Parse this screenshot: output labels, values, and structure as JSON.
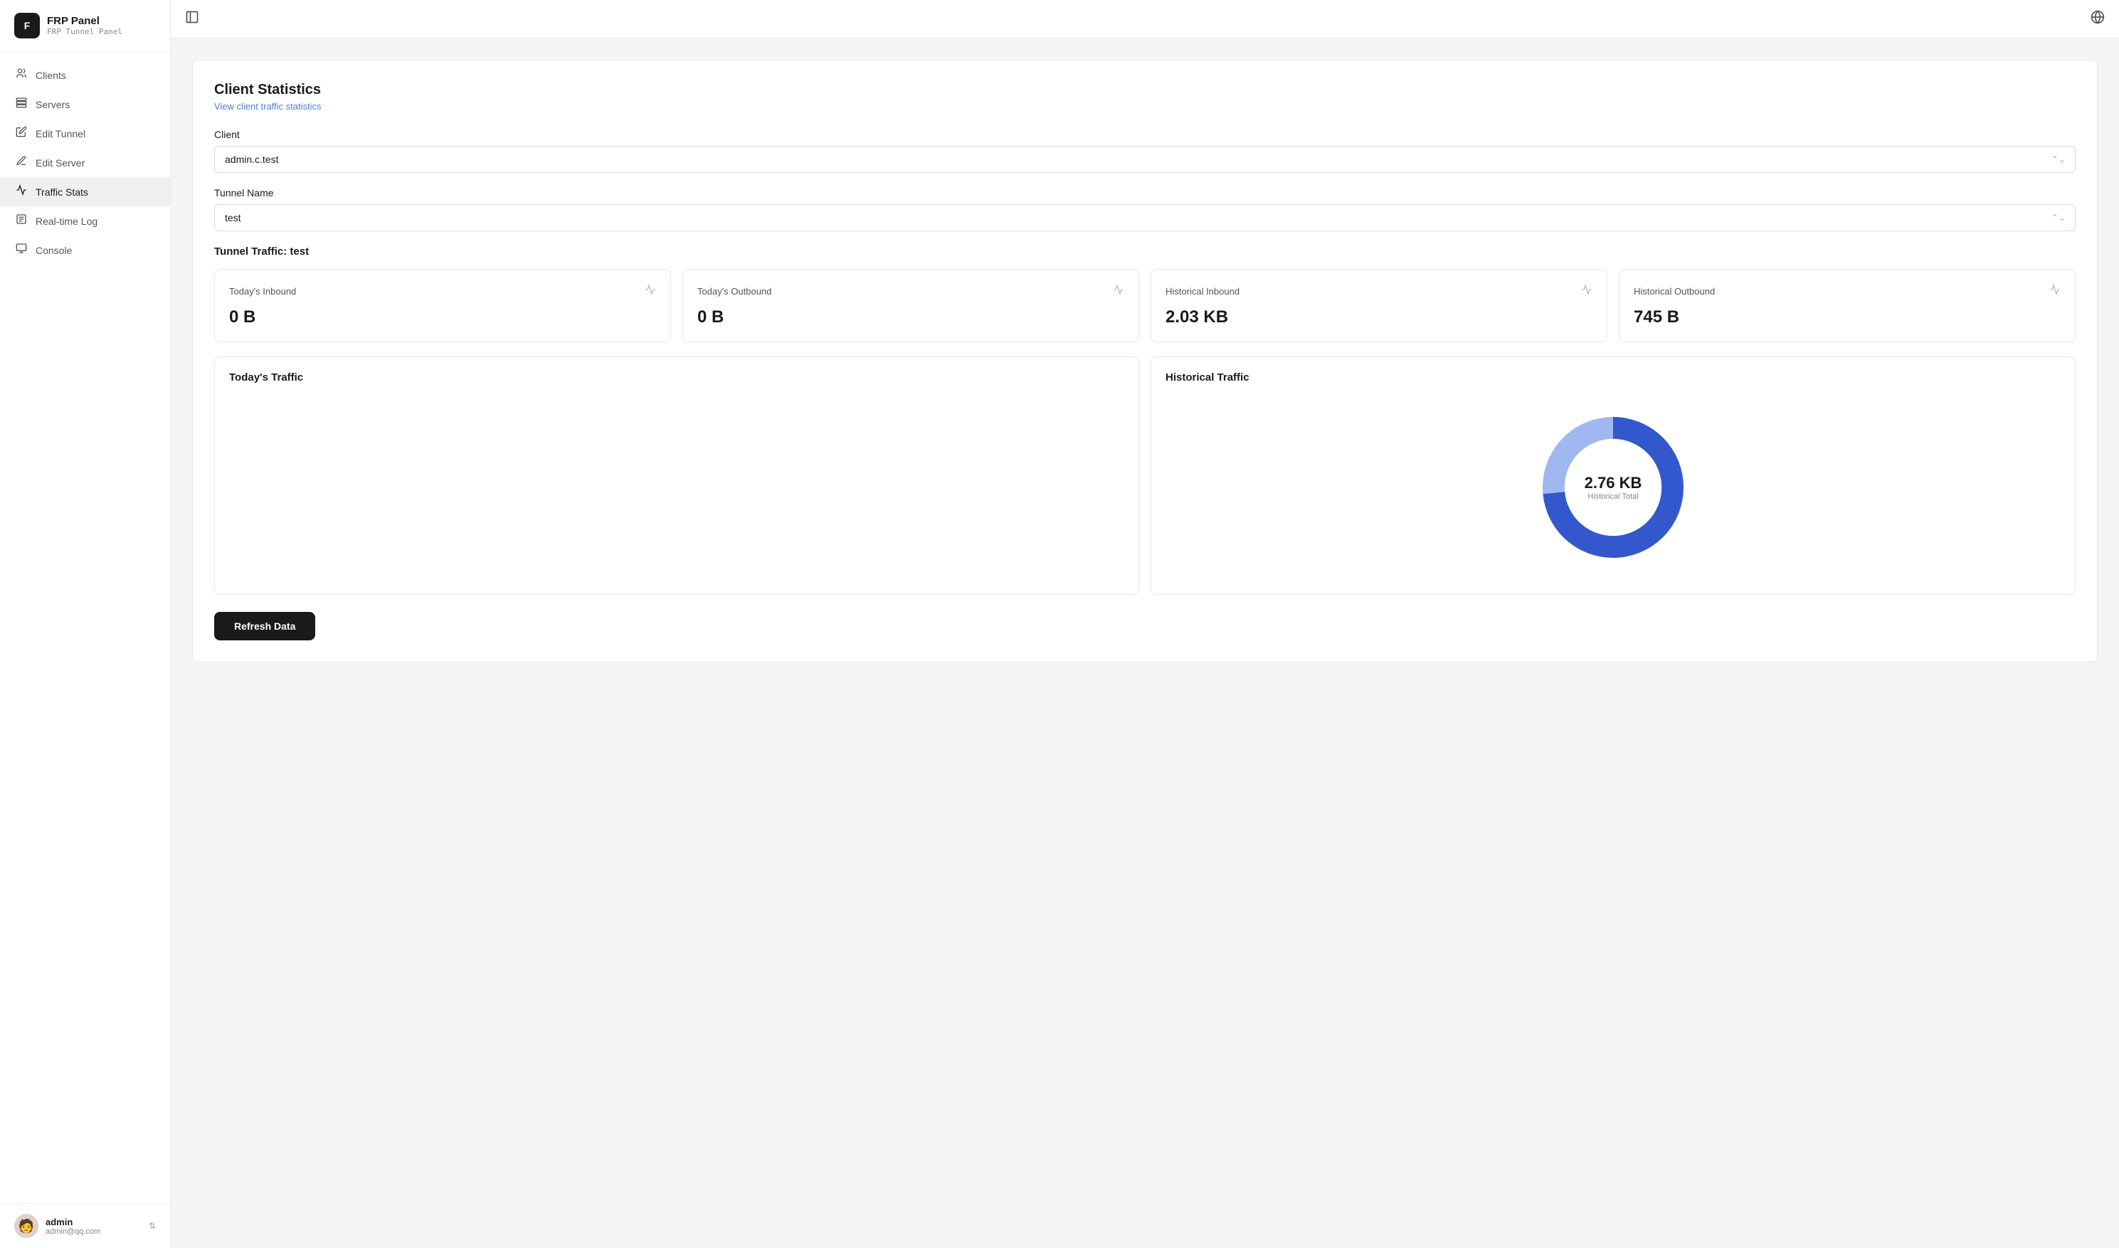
{
  "app": {
    "name": "FRP Panel",
    "subtitle": "FRP Tunnel Panel",
    "logo_char": "F"
  },
  "sidebar": {
    "items": [
      {
        "id": "clients",
        "label": "Clients",
        "icon": "👥"
      },
      {
        "id": "servers",
        "label": "Servers",
        "icon": "🖥"
      },
      {
        "id": "edit-tunnel",
        "label": "Edit Tunnel",
        "icon": "✏️"
      },
      {
        "id": "edit-server",
        "label": "Edit Server",
        "icon": "🖊"
      },
      {
        "id": "traffic-stats",
        "label": "Traffic Stats",
        "icon": "📊",
        "active": true
      },
      {
        "id": "realtime-log",
        "label": "Real-time Log",
        "icon": "📋"
      },
      {
        "id": "console",
        "label": "Console",
        "icon": "💻"
      }
    ]
  },
  "user": {
    "name": "admin",
    "email": "admin@qq.com",
    "avatar": "🧑"
  },
  "main": {
    "page_title": "Client Statistics",
    "page_subtitle": "View client traffic statistics",
    "client_label": "Client",
    "client_value": "admin.c.test",
    "tunnel_name_label": "Tunnel Name",
    "tunnel_name_value": "test",
    "tunnel_traffic_label": "Tunnel Traffic: test",
    "stats": [
      {
        "title": "Today's Inbound",
        "value": "0 B"
      },
      {
        "title": "Today's Outbound",
        "value": "0 B"
      },
      {
        "title": "Historical Inbound",
        "value": "2.03 KB"
      },
      {
        "title": "Historical Outbound",
        "value": "745 B"
      }
    ],
    "today_traffic_title": "Today's Traffic",
    "historical_traffic_title": "Historical Traffic",
    "donut": {
      "total_value": "2.76 KB",
      "total_label": "Historical Total",
      "inbound_kb": 2.03,
      "outbound_b": 745,
      "total_kb": 2.76
    },
    "refresh_button": "Refresh Data"
  }
}
